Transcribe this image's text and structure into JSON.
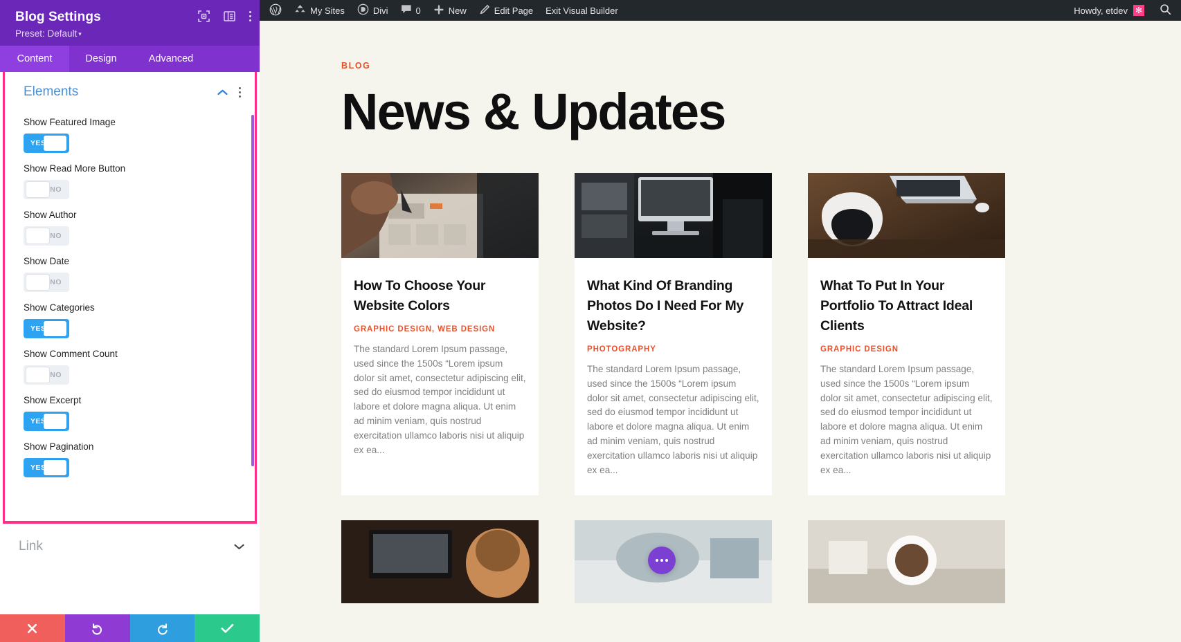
{
  "settings_panel": {
    "title": "Blog Settings",
    "preset_label": "Preset: Default",
    "preset_caret": "▾",
    "header_icons": [
      "expand-icon",
      "layout-icon",
      "more-vertical-icon"
    ],
    "tabs": [
      {
        "label": "Content",
        "active": true
      },
      {
        "label": "Design",
        "active": false
      },
      {
        "label": "Advanced",
        "active": false
      }
    ],
    "group": {
      "title": "Elements",
      "collapse_icon": "chevron-up-icon",
      "more_icon": "more-vertical-icon",
      "fields": [
        {
          "label": "Show Featured Image",
          "value": "YES",
          "on": true
        },
        {
          "label": "Show Read More Button",
          "value": "NO",
          "on": false
        },
        {
          "label": "Show Author",
          "value": "NO",
          "on": false
        },
        {
          "label": "Show Date",
          "value": "NO",
          "on": false
        },
        {
          "label": "Show Categories",
          "value": "YES",
          "on": true
        },
        {
          "label": "Show Comment Count",
          "value": "NO",
          "on": false
        },
        {
          "label": "Show Excerpt",
          "value": "YES",
          "on": true
        },
        {
          "label": "Show Pagination",
          "value": "YES",
          "on": true
        }
      ]
    },
    "link_section": {
      "title": "Link",
      "expand_icon": "chevron-down-icon"
    },
    "actions": [
      {
        "name": "cancel",
        "icon": "close-icon",
        "color": "#f15f5c"
      },
      {
        "name": "undo",
        "icon": "undo-icon",
        "color": "#8e3ad3"
      },
      {
        "name": "redo",
        "icon": "redo-icon",
        "color": "#2e9ede"
      },
      {
        "name": "save",
        "icon": "checkmark-icon",
        "color": "#2bc98c"
      }
    ],
    "accent_border_color": "#ff2d87",
    "header_color": "#6a27b8",
    "tabbar_color": "#7f32cd",
    "toggle_on_color": "#2ea3f2"
  },
  "adminbar": {
    "items": [
      {
        "label": "",
        "icon": "wordpress-icon"
      },
      {
        "label": "My Sites",
        "icon": "sites-icon"
      },
      {
        "label": "Divi",
        "icon": "divi-icon"
      },
      {
        "label": "0",
        "icon": "comment-icon"
      },
      {
        "label": "New",
        "icon": "plus-icon"
      },
      {
        "label": "Edit Page",
        "icon": "pencil-icon"
      },
      {
        "label": "Exit Visual Builder",
        "icon": ""
      }
    ],
    "howdy": "Howdy, etdev",
    "avatar_glyph": "✻",
    "search_icon": "search-icon",
    "background": "#23282d"
  },
  "page": {
    "eyebrow": "BLOG",
    "title": "News & Updates",
    "accent_color": "#e8502a",
    "background": "#f5f4ed",
    "posts": [
      {
        "title": "How To Choose Your Website Colors",
        "categories": "GRAPHIC DESIGN, WEB DESIGN",
        "excerpt": "The standard Lorem Ipsum passage, used since the 1500s “Lorem ipsum dolor sit amet, consectetur adipiscing elit, sed do eiusmod tempor incididunt ut labore et dolore magna aliqua. Ut enim ad minim veniam, quis nostrud exercitation ullamco laboris nisi ut aliquip ex ea...",
        "image_alt": "hand sketching wireframes on paper"
      },
      {
        "title": "What Kind Of Branding Photos Do I Need For My Website?",
        "categories": "PHOTOGRAPHY",
        "excerpt": "The standard Lorem Ipsum passage, used since the 1500s “Lorem ipsum dolor sit amet, consectetur adipiscing elit, sed do eiusmod tempor incididunt ut labore et dolore magna aliqua. Ut enim ad minim veniam, quis nostrud exercitation ullamco laboris nisi ut aliquip ex ea...",
        "image_alt": "desktop computer on desk by window"
      },
      {
        "title": "What To Put In Your Portfolio To Attract Ideal Clients",
        "categories": "GRAPHIC DESIGN",
        "excerpt": "The standard Lorem Ipsum passage, used since the 1500s “Lorem ipsum dolor sit amet, consectetur adipiscing elit, sed do eiusmod tempor incididunt ut labore et dolore magna aliqua. Ut enim ad minim veniam, quis nostrud exercitation ullamco laboris nisi ut aliquip ex ea...",
        "image_alt": "laptop on wooden desk with white chair"
      }
    ],
    "posts_row2": [
      {
        "image_alt": "person with laptop"
      },
      {
        "image_alt": "bright workspace"
      },
      {
        "image_alt": "coffee cup on desk"
      }
    ],
    "fab_icon": "ellipsis-icon",
    "fab_color": "#7b3fd1"
  }
}
